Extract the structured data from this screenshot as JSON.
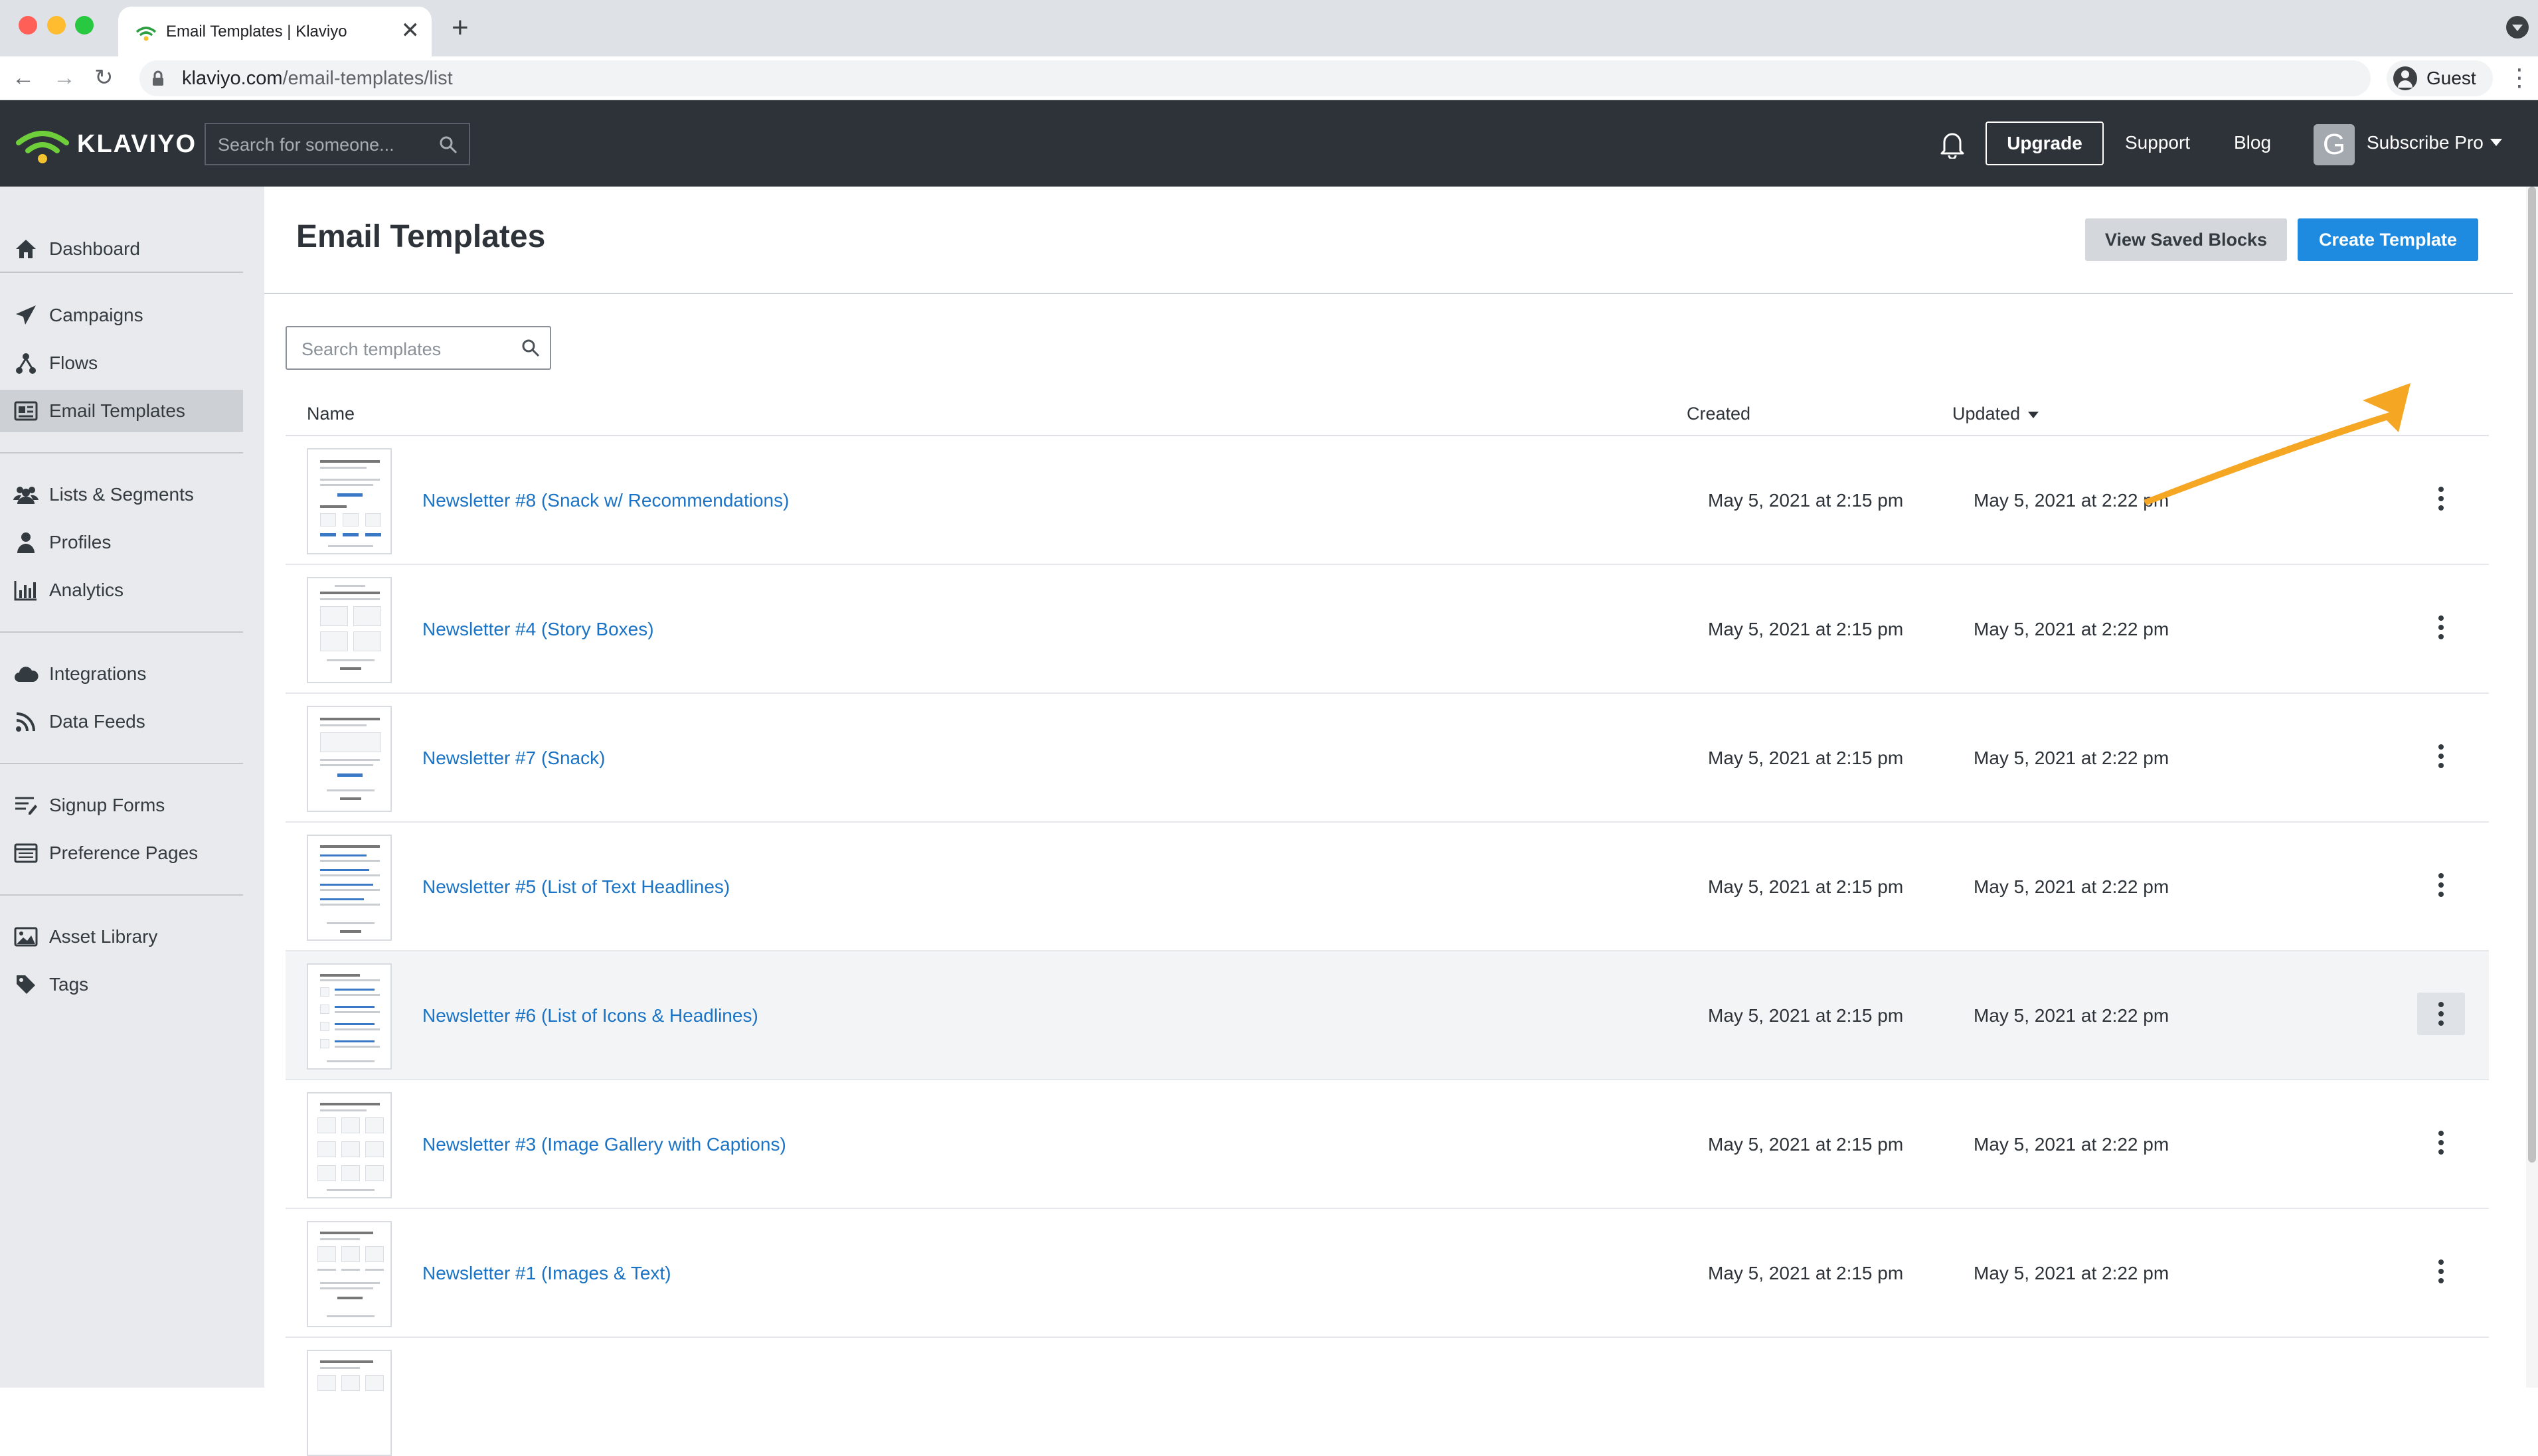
{
  "browser": {
    "tab_title": "Email Templates | Klaviyo",
    "tab_close": "✕",
    "new_tab": "+",
    "url_host": "klaviyo.com",
    "url_path": "/email-templates/list",
    "profile_label": "Guest",
    "back": "←",
    "forward": "→",
    "reload": "↻",
    "menu": "⋮"
  },
  "header": {
    "logo_text": "KLAVIYO",
    "search_placeholder": "Search for someone...",
    "upgrade_label": "Upgrade",
    "support_label": "Support",
    "blog_label": "Blog",
    "account_initial": "G",
    "account_name": "Subscribe Pro"
  },
  "sidebar": {
    "items": [
      {
        "label": "Dashboard",
        "icon": "home-icon"
      },
      {
        "label": "Campaigns",
        "icon": "paper-plane-icon"
      },
      {
        "label": "Flows",
        "icon": "flows-icon"
      },
      {
        "label": "Email Templates",
        "icon": "template-icon",
        "active": true
      },
      {
        "label": "Lists & Segments",
        "icon": "users-icon"
      },
      {
        "label": "Profiles",
        "icon": "user-icon"
      },
      {
        "label": "Analytics",
        "icon": "bar-chart-icon"
      },
      {
        "label": "Integrations",
        "icon": "cloud-icon"
      },
      {
        "label": "Data Feeds",
        "icon": "rss-icon"
      },
      {
        "label": "Signup Forms",
        "icon": "form-icon"
      },
      {
        "label": "Preference Pages",
        "icon": "preferences-icon"
      },
      {
        "label": "Asset Library",
        "icon": "image-icon"
      },
      {
        "label": "Tags",
        "icon": "tag-icon"
      }
    ]
  },
  "main": {
    "title": "Email Templates",
    "view_saved_blocks_label": "View Saved Blocks",
    "create_template_label": "Create Template",
    "search_placeholder": "Search templates",
    "columns": {
      "name": "Name",
      "created": "Created",
      "updated": "Updated"
    },
    "rows": [
      {
        "name": "Newsletter #8 (Snack w/ Recommendations)",
        "created": "May 5, 2021 at 2:15 pm",
        "updated": "May 5, 2021 at 2:22 pm"
      },
      {
        "name": "Newsletter #4 (Story Boxes)",
        "created": "May 5, 2021 at 2:15 pm",
        "updated": "May 5, 2021 at 2:22 pm"
      },
      {
        "name": "Newsletter #7 (Snack)",
        "created": "May 5, 2021 at 2:15 pm",
        "updated": "May 5, 2021 at 2:22 pm"
      },
      {
        "name": "Newsletter #5 (List of Text Headlines)",
        "created": "May 5, 2021 at 2:15 pm",
        "updated": "May 5, 2021 at 2:22 pm"
      },
      {
        "name": "Newsletter #6 (List of Icons & Headlines)",
        "created": "May 5, 2021 at 2:15 pm",
        "updated": "May 5, 2021 at 2:22 pm"
      },
      {
        "name": "Newsletter #3 (Image Gallery with Captions)",
        "created": "May 5, 2021 at 2:15 pm",
        "updated": "May 5, 2021 at 2:22 pm"
      },
      {
        "name": "Newsletter #1 (Images & Text)",
        "created": "May 5, 2021 at 2:15 pm",
        "updated": "May 5, 2021 at 2:22 pm"
      }
    ]
  },
  "colors": {
    "header_bg": "#2d3338",
    "accent_blue": "#1e8ae0",
    "link_blue": "#1a73c4",
    "annotation_arrow": "#f5a623",
    "logo_green": "#6fcf3a"
  }
}
